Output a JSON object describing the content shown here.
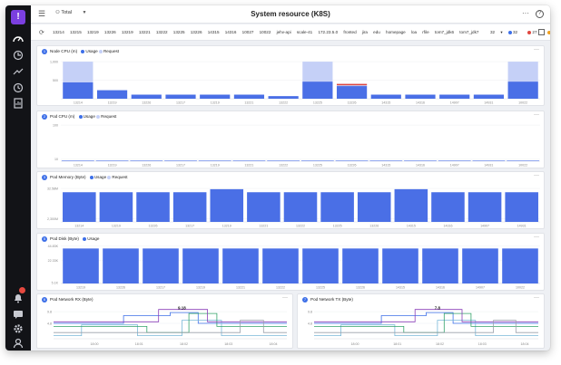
{
  "header": {
    "title": "System resource (K8S)",
    "selector": "Total",
    "more": "···",
    "help": "?"
  },
  "filters": {
    "tags": [
      "13214",
      "13215",
      "13219",
      "13226",
      "13219",
      "13221",
      "13222",
      "13225",
      "13226",
      "14315",
      "14316",
      "10027",
      "10022",
      "jehv-api",
      "scale-41",
      "172.23.5.0",
      "fronted",
      "jira",
      "edu",
      "homepage",
      "loa",
      "rfile",
      "tom7_jdk6",
      "tom7_jdk7",
      "tom8_sysdel"
    ],
    "count_label": "32",
    "status": [
      {
        "value": "32",
        "color": "#3d6fe8"
      },
      {
        "value": "27",
        "color": "#e0473f"
      },
      {
        "value": "0",
        "color": "#f0a020"
      }
    ]
  },
  "nodes": [
    "13214",
    "13219",
    "13226",
    "13217",
    "13219",
    "13221",
    "13222",
    "13225",
    "13226",
    "14315",
    "14316",
    "14907",
    "14931",
    "10022"
  ],
  "nodes_short": [
    "13219",
    "13226",
    "13217",
    "13219",
    "13221",
    "13222",
    "13225",
    "13226",
    "14315",
    "14316",
    "14907",
    "10022"
  ],
  "panels": {
    "node_cpu": {
      "num": "1",
      "title": "Node CPU (m)",
      "legend": [
        "Usage",
        "Request"
      ],
      "menu": "···",
      "y_ticks": [
        "1,000",
        "500"
      ],
      "chart_data": {
        "type": "bar",
        "ylim": [
          0,
          1100
        ],
        "usage": [
          440,
          230,
          110,
          110,
          110,
          110,
          70,
          460,
          340,
          110,
          110,
          110,
          110,
          460
        ],
        "request": [
          1000,
          0,
          0,
          0,
          0,
          0,
          0,
          1000,
          400,
          0,
          0,
          0,
          0,
          1000
        ]
      }
    },
    "pod_cpu": {
      "num": "2",
      "title": "Pod CPU (m)",
      "legend": [
        "Usage",
        "Request"
      ],
      "menu": "···",
      "y_ticks": [
        "100",
        "10"
      ],
      "chart_data": {
        "type": "bar",
        "ylim": [
          0,
          120
        ],
        "usage": [
          1,
          1,
          1,
          1,
          1,
          1,
          1,
          1,
          1,
          1,
          1,
          1,
          1,
          1
        ]
      }
    },
    "pod_memory": {
      "num": "3",
      "title": "Pod Memory (Byte)",
      "legend": [
        "Usage",
        "Request"
      ],
      "menu": "···",
      "y_ticks": [
        "32.58M",
        "2,300M"
      ],
      "chart_data": {
        "type": "bar",
        "ylim": [
          0,
          100
        ],
        "usage": [
          78,
          78,
          78,
          78,
          86,
          78,
          78,
          78,
          78,
          86,
          78,
          78,
          78
        ]
      }
    },
    "pod_disk": {
      "num": "5",
      "title": "Pod Disk (Byte)",
      "legend": [
        "Usage"
      ],
      "menu": "···",
      "y_ticks": [
        "44.83K",
        "22.33K",
        "5.1K"
      ],
      "chart_data": {
        "type": "bar",
        "ylim": [
          0,
          100
        ],
        "usage": [
          92,
          92,
          92,
          92,
          92,
          92,
          92,
          92,
          92,
          92,
          92,
          92
        ]
      }
    },
    "net_rx": {
      "num": "6",
      "title": "Pod Network RX (Byte)",
      "menu": "···",
      "y_ticks": [
        "9.8",
        "4.8"
      ],
      "x_ticks": [
        "18:00",
        "18:01",
        "18:02",
        "18:03",
        "18:04"
      ],
      "peak": "9.18"
    },
    "net_tx": {
      "num": "7",
      "title": "Pod Network TX (Byte)",
      "menu": "···",
      "y_ticks": [
        "9.8",
        "4.8"
      ],
      "x_ticks": [
        "18:00",
        "18:01",
        "18:02",
        "18:03",
        "18:04"
      ],
      "peak": "7.8"
    }
  },
  "colors": {
    "usage": "#4a6fe6",
    "request": "#c5d0f7",
    "request_line": "#e0473f",
    "series": [
      "#3d6fe8",
      "#7ab8d8",
      "#33a36a",
      "#8a3fb8",
      "#9aa0aa"
    ]
  }
}
